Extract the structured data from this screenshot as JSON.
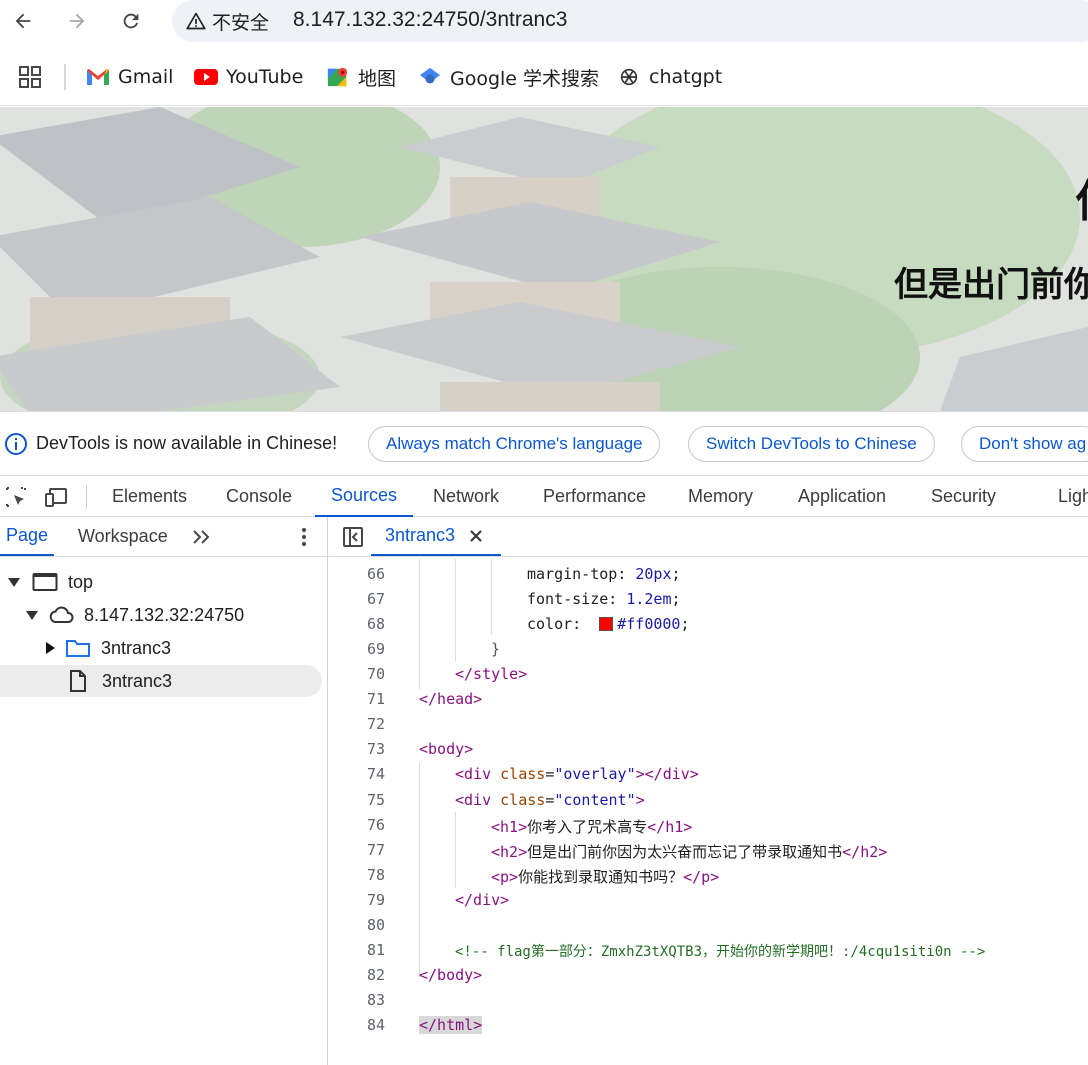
{
  "browser": {
    "security_label": "不安全",
    "url": "8.147.132.32:24750/3ntranc3",
    "bookmarks": [
      {
        "label": "Gmail",
        "icon": "gmail-icon"
      },
      {
        "label": "YouTube",
        "icon": "youtube-icon"
      },
      {
        "label": "地图",
        "icon": "maps-icon"
      },
      {
        "label": "Google 学术搜索",
        "icon": "scholar-icon"
      },
      {
        "label": "chatgpt",
        "icon": "openai-icon"
      }
    ]
  },
  "page": {
    "h1_partial": "你",
    "h2_partial": "但是出门前你"
  },
  "infobar": {
    "message": "DevTools is now available in Chinese!",
    "btn_match": "Always match Chrome's language",
    "btn_switch": "Switch DevTools to Chinese",
    "btn_dont_show": "Don't show ag"
  },
  "devtools": {
    "tabs": [
      "Elements",
      "Console",
      "Sources",
      "Network",
      "Performance",
      "Memory",
      "Application",
      "Security",
      "Ligh"
    ],
    "active_tab": "Sources",
    "navigator": {
      "tabs": [
        "Page",
        "Workspace"
      ],
      "active_tab": "Page",
      "tree": {
        "top": "top",
        "host": "8.147.132.32:24750",
        "folder": "3ntranc3",
        "file": "3ntranc3"
      }
    },
    "editor": {
      "open_file": "3ntranc3",
      "line_numbers": [
        "66",
        "67",
        "68",
        "69",
        "70",
        "71",
        "72",
        "73",
        "74",
        "75",
        "76",
        "77",
        "78",
        "79",
        "80",
        "81",
        "82",
        "83",
        "84"
      ],
      "code": {
        "l66_prop": "margin-top",
        "l66_val": "20px",
        "l67_prop": "font-size",
        "l67_val": "1.2em",
        "l68_prop": "color",
        "l68_val": "#ff0000",
        "l69": "}",
        "l70": "</style>",
        "l71": "</head>",
        "l73": "<body>",
        "l74_cls": "\"overlay\"",
        "l75_cls": "\"content\"",
        "l76_text": "你考入了咒术高专",
        "l77_text": "但是出门前你因为太兴奋而忘记了带录取通知书",
        "l78_text": "你能找到录取通知书吗？",
        "l79": "</div>",
        "l81_comment": "<!-- flag第一部分：ZmxhZ3tXQTB3，开始你的新学期吧！:/4cqu1siti0n -->",
        "l82": "</body>",
        "l84": "</html>"
      }
    }
  },
  "colors": {
    "accent": "#0b57d0",
    "swatch": "#ff0000"
  }
}
